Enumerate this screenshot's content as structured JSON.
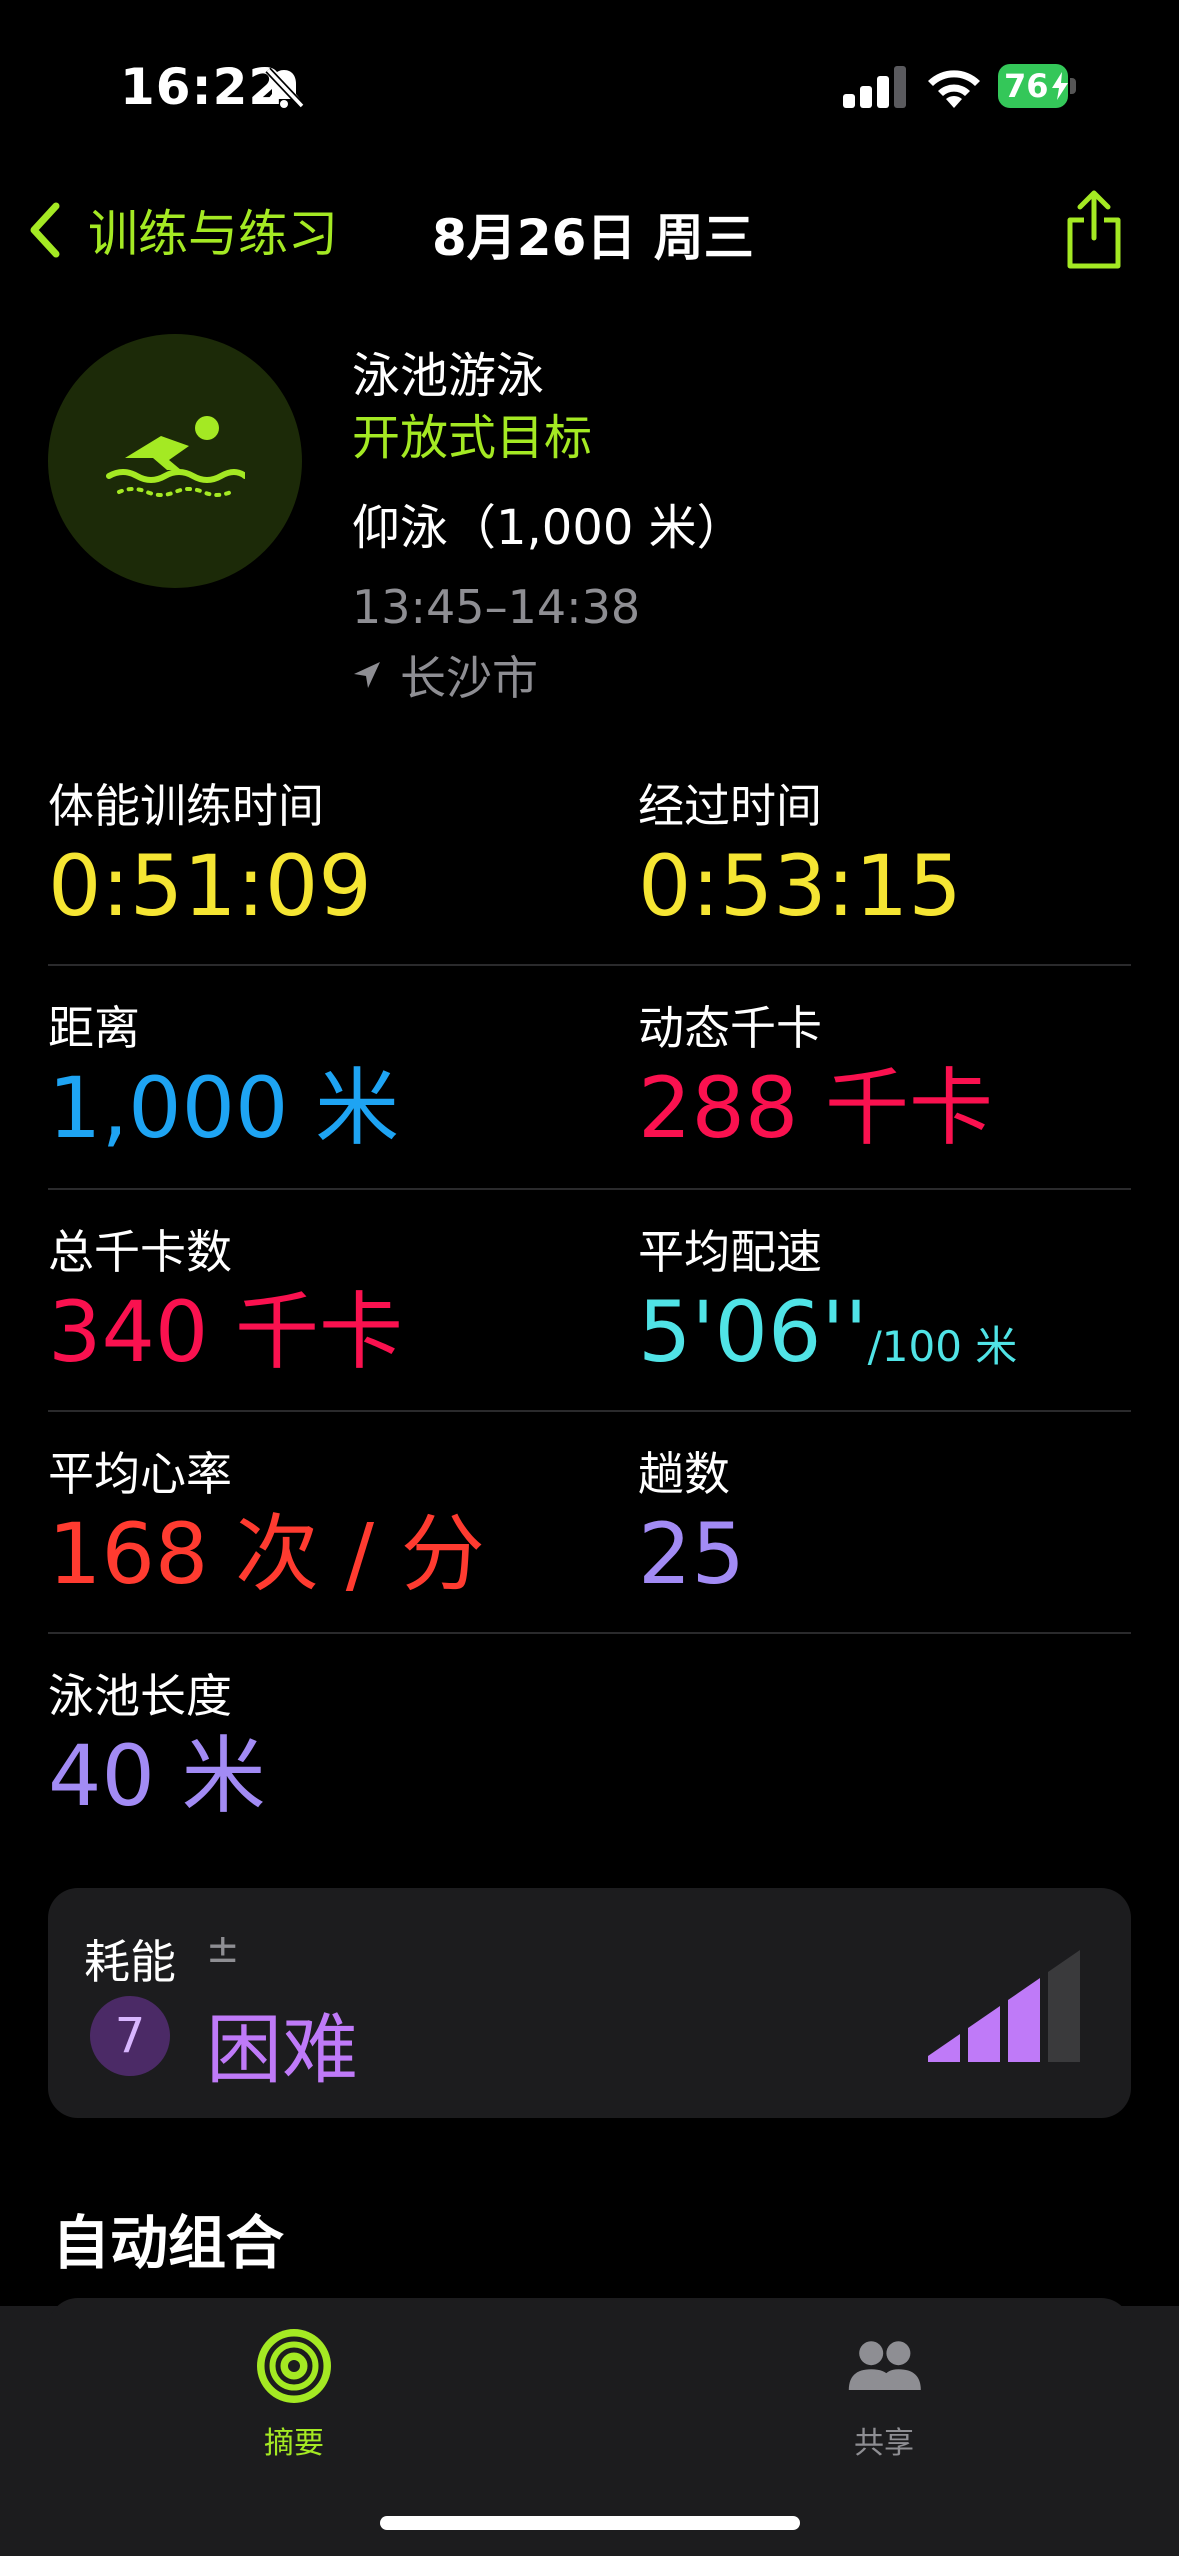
{
  "status_bar": {
    "time": "16:22",
    "battery": "76"
  },
  "nav": {
    "back_label": "训练与练习",
    "title": "8月26日 周三"
  },
  "workout": {
    "name": "泳池游泳",
    "goal": "开放式目标",
    "detail": "仰泳（1,000 米）",
    "time_range": "13:45–14:38",
    "location": "长沙市"
  },
  "metrics": {
    "workout_time": {
      "label": "体能训练时间",
      "value": "0:51:09"
    },
    "elapsed_time": {
      "label": "经过时间",
      "value": "0:53:15"
    },
    "distance": {
      "label": "距离",
      "value": "1,000 米"
    },
    "active_cal": {
      "label": "动态千卡",
      "value": "288 千卡"
    },
    "total_cal": {
      "label": "总千卡数",
      "value": "340 千卡"
    },
    "avg_pace": {
      "label": "平均配速",
      "value": "5'06''",
      "unit": "/100 米"
    },
    "avg_hr": {
      "label": "平均心率",
      "value": "168 次 / 分"
    },
    "laps": {
      "label": "趟数",
      "value": "25"
    },
    "pool_length": {
      "label": "泳池长度",
      "value": "40 米"
    }
  },
  "effort": {
    "label": "耗能",
    "adjust_symbol": "±",
    "score": "7",
    "level": "困难",
    "filled_bars": 3,
    "total_bars": 4
  },
  "section": {
    "auto_sets_title": "自动组合"
  },
  "tabs": {
    "summary": "摘要",
    "sharing": "共享"
  },
  "colors": {
    "accent_green": "#a4e923",
    "yellow": "#f5e533",
    "blue": "#1ea4f3",
    "red": "#fa114f",
    "cyan": "#50e3e6",
    "orange_red": "#ff3b30",
    "purple": "#a28bf4",
    "effort_purple": "#bf7af8"
  }
}
